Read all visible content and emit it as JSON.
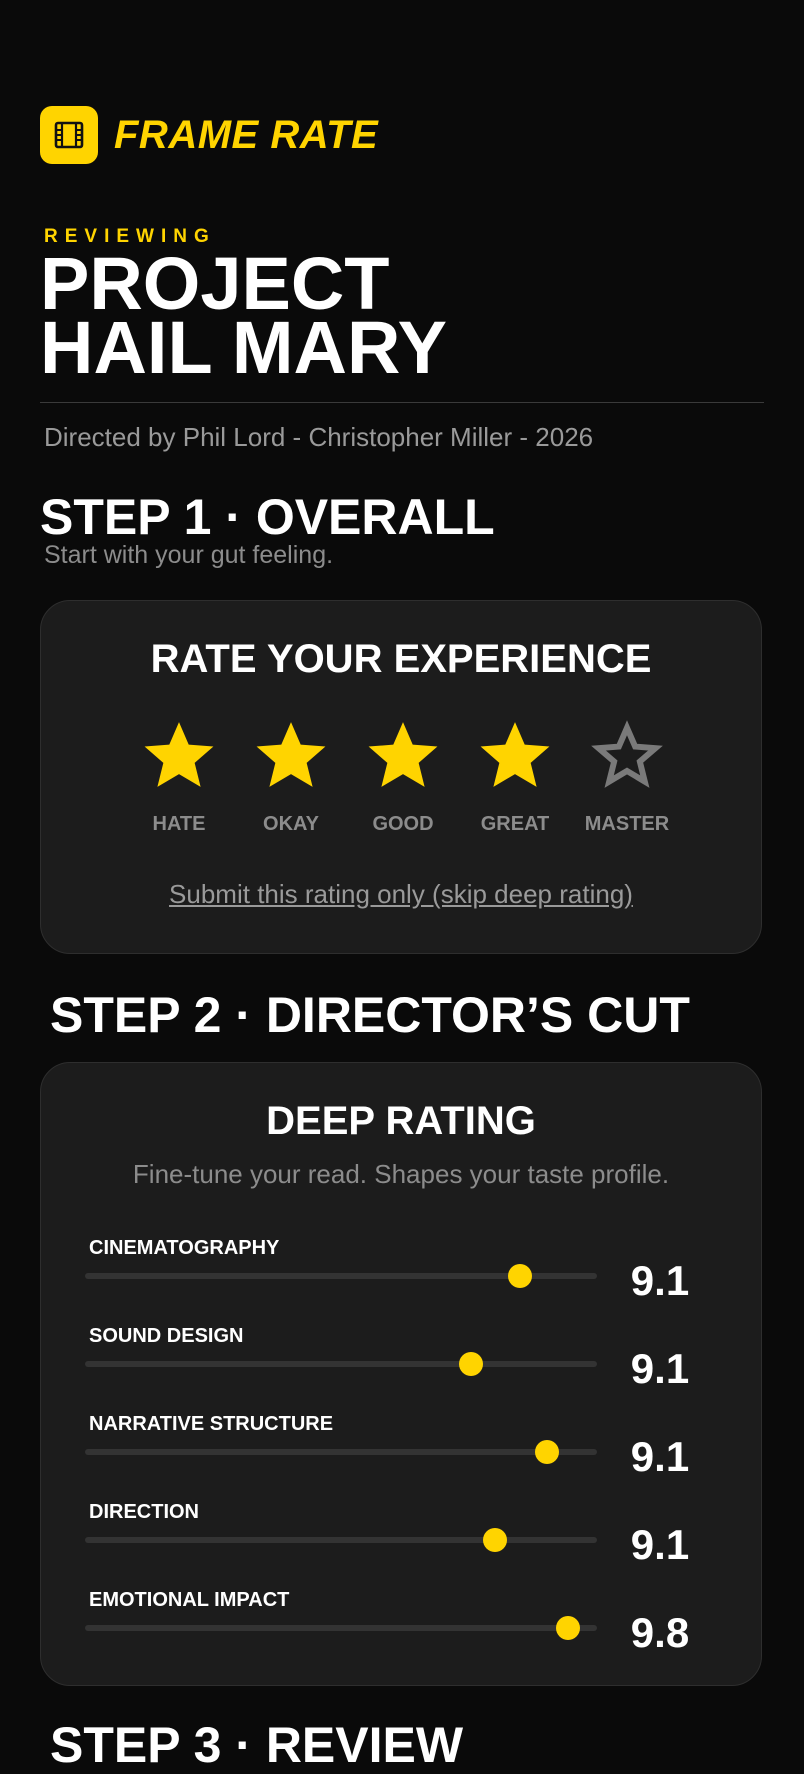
{
  "brand": {
    "name": "FRAME RATE",
    "icon": "film-icon",
    "accent": "#ffd400"
  },
  "movie": {
    "eyebrow": "REVIEWING",
    "title_line1": "PROJECT",
    "title_line2": "HAIL MARY",
    "credits": "Directed by Phil Lord - Christopher Miller - 2026"
  },
  "step1": {
    "heading": "STEP 1 · OVERALL",
    "subtitle": "Start with your gut feeling.",
    "card_title": "RATE YOUR EXPERIENCE",
    "rating": 4,
    "stars": [
      {
        "label": "HATE",
        "filled": true
      },
      {
        "label": "OKAY",
        "filled": true
      },
      {
        "label": "GOOD",
        "filled": true
      },
      {
        "label": "GREAT",
        "filled": true
      },
      {
        "label": "MASTER",
        "filled": false
      }
    ],
    "skip_link": "Submit this rating only (skip deep rating)"
  },
  "step2": {
    "heading": "STEP 2 · DIRECTOR’S CUT",
    "card_title": "DEEP RATING",
    "description": "Fine-tune your read. Shapes your taste profile.",
    "sliders": [
      {
        "label": "CINEMATOGRAPHY",
        "value": "9.1",
        "fraction": 0.85
      },
      {
        "label": "SOUND DESIGN",
        "value": "9.1",
        "fraction": 0.753
      },
      {
        "label": "NARRATIVE STRUCTURE",
        "value": "9.1",
        "fraction": 0.903
      },
      {
        "label": "DIRECTION",
        "value": "9.1",
        "fraction": 0.8
      },
      {
        "label": "EMOTIONAL IMPACT",
        "value": "9.8",
        "fraction": 0.944
      }
    ]
  },
  "step3": {
    "heading": "STEP 3 · REVIEW"
  }
}
